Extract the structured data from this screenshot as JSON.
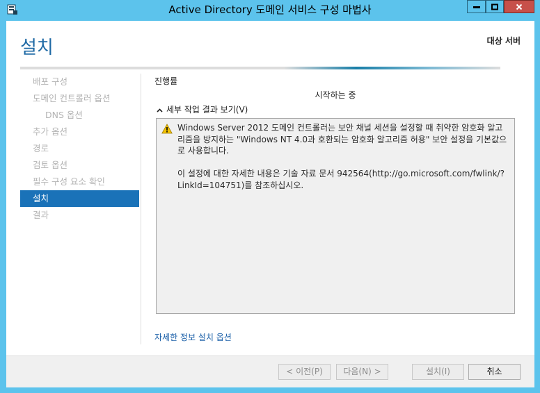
{
  "window": {
    "title": "Active Directory 도메인 서비스 구성 마법사"
  },
  "header": {
    "page_title": "설치",
    "target_server_label": "대상 서버"
  },
  "sidebar": {
    "items": [
      {
        "label": "배포 구성",
        "state": "inactive"
      },
      {
        "label": "도메인 컨트롤러 옵션",
        "state": "inactive"
      },
      {
        "label": "DNS 옵션",
        "state": "inactive",
        "sub": true
      },
      {
        "label": "추가 옵션",
        "state": "inactive"
      },
      {
        "label": "경로",
        "state": "inactive"
      },
      {
        "label": "검토 옵션",
        "state": "inactive"
      },
      {
        "label": "필수 구성 요소 확인",
        "state": "inactive"
      },
      {
        "label": "설치",
        "state": "active"
      },
      {
        "label": "결과",
        "state": "inactive"
      }
    ]
  },
  "main": {
    "progress_label": "진행률",
    "status_text": "시작하는 중",
    "details_toggle_label": "세부 작업 결과 보기(V)",
    "detail_message": "Windows Server 2012 도메인 컨트롤러는 보안 채널 세션을 설정할 때 취약한 암호화 알고리즘을 방지하는 \"Windows NT 4.0과 호환되는 암호화 알고리즘 허용\" 보안 설정을 기본값으로 사용합니다.\n\n이 설정에 대한 자세한 내용은 기술 자료 문서 942564(http://go.microsoft.com/fwlink/?LinkId=104751)를 참조하십시오.",
    "more_link": "자세한 정보 설치 옵션"
  },
  "footer": {
    "prev_label": "< 이전(P)",
    "next_label": "다음(N) >",
    "install_label": "설치(I)",
    "cancel_label": "취소"
  },
  "colors": {
    "frame": "#5cc3ec",
    "accent": "#1a72b8",
    "title_blue": "#1f6aa5",
    "close_button": "#c7504a",
    "warning": "#f2c200"
  }
}
